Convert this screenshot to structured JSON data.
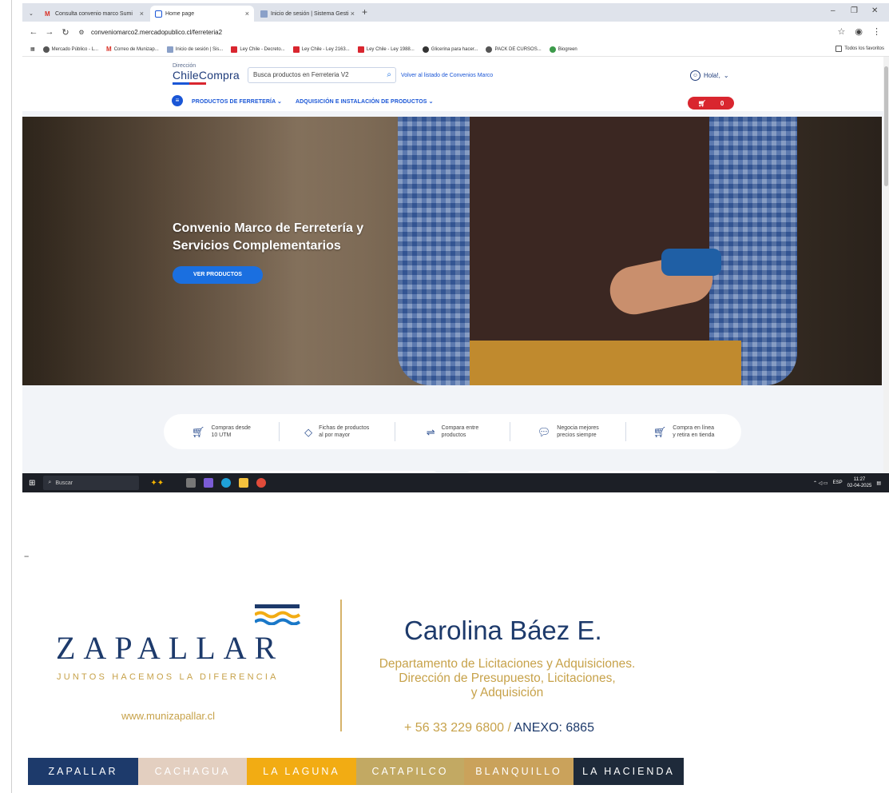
{
  "browser": {
    "tabs": [
      {
        "label": "Consulta convenio marco Sumi",
        "active": false
      },
      {
        "label": "Home page",
        "active": true
      },
      {
        "label": "Inicio de sesión | Sistema Gesti",
        "active": false
      }
    ],
    "url": "conveniomarco2.mercadopublico.cl/ferreteria2",
    "bookmarks": [
      "Mercado Público - L...",
      "Correo de Munizap...",
      "Inicio de sesión | Sis...",
      "Ley Chile - Decreto...",
      "Ley Chile - Ley 2163...",
      "Ley Chile - Ley 1988...",
      "Glicerina para hacer...",
      "PACK DE CURSOS...",
      "Biogreen"
    ],
    "favorites_label": "Todos los favoritos"
  },
  "site": {
    "logo_small": "Dirección",
    "logo_big": "ChileCompra",
    "logo_bar_colors": [
      "#1a56d6",
      "#d9262f"
    ],
    "search_placeholder": "Busca productos en Ferreteria V2",
    "back_link": "Volver al listado de Convenios Marco",
    "user_greeting": "Hola!,",
    "nav": [
      "PRODUCTOS DE FERRETERÍA",
      "ADQUISICIÓN E INSTALACIÓN DE PRODUCTOS"
    ],
    "cart_count": "0",
    "hero_title": "Convenio Marco de Ferretería y Servicios Complementarios",
    "hero_button": "VER PRODUCTOS",
    "features": [
      {
        "line1": "Compras desde",
        "line2": "10 UTM",
        "icon": "cart-icon"
      },
      {
        "line1": "Fichas de productos",
        "line2": "al por mayor",
        "icon": "tag-icon"
      },
      {
        "line1": "Compara entre",
        "line2": "productos",
        "icon": "sliders-icon"
      },
      {
        "line1": "Negocia mejores",
        "line2": "precios siempre",
        "icon": "chat-icon"
      },
      {
        "line1": "Compra en línea",
        "line2": "y retira en tienda",
        "icon": "cart-icon"
      }
    ]
  },
  "taskbar": {
    "search_label": "Buscar",
    "lang": "ESP",
    "time": "11:27",
    "date": "02-04-2025"
  },
  "signature": {
    "separator": "--",
    "org": "ZAPALLAR",
    "tagline": "JUNTOS HACEMOS LA DIFERENCIA",
    "website": "www.munizapallar.cl",
    "name": "Carolina Báez E.",
    "dept_line1": "Departamento de Licitaciones y Adquisiciones.",
    "dept_line2": "Dirección de Presupuesto, Licitaciones,",
    "dept_line3": "y Adquisición",
    "phone": "+ 56 33 229 6800 /",
    "anexo": "ANEXO: 6865",
    "places": [
      {
        "label": "ZAPALLAR",
        "bg": "#1d3a6b",
        "fg": "#ffffff"
      },
      {
        "label": "CACHAGUA",
        "bg": "#e3cfc0",
        "fg": "#ffffff"
      },
      {
        "label": "LA LAGUNA",
        "bg": "#f2ac13",
        "fg": "#ffffff"
      },
      {
        "label": "CATAPILCO",
        "bg": "#c2a963",
        "fg": "#ffffff"
      },
      {
        "label": "BLANQUILLO",
        "bg": "#caa25b",
        "fg": "#ffffff"
      },
      {
        "label": "LA HACIENDA",
        "bg": "#1e2a3a",
        "fg": "#ffffff"
      }
    ]
  }
}
